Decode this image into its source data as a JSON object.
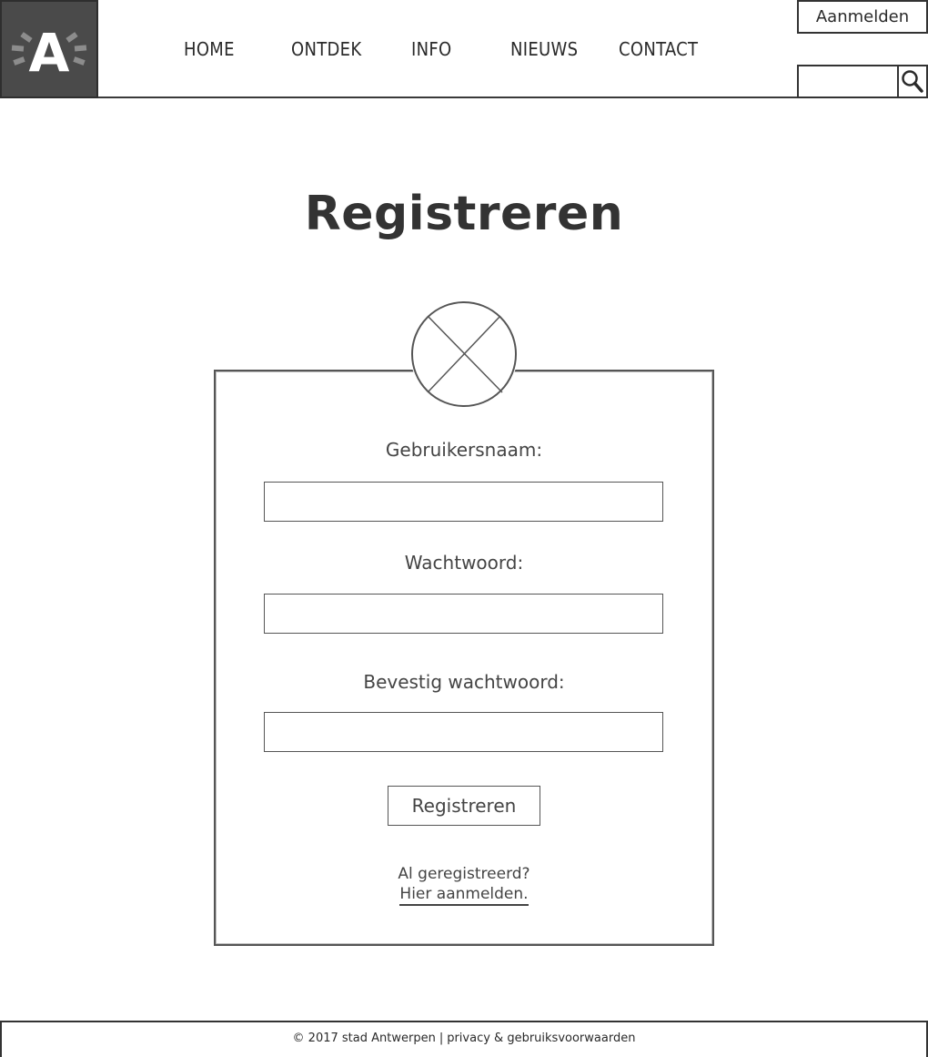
{
  "header": {
    "logo_letter": "A",
    "nav": [
      {
        "label": "HOME"
      },
      {
        "label": "ONTDEK"
      },
      {
        "label": "INFO"
      },
      {
        "label": "NIEUWS"
      },
      {
        "label": "CONTACT"
      }
    ],
    "login_label": "Aanmelden",
    "search_value": "",
    "search_icon": "search-icon"
  },
  "main": {
    "title": "Registreren",
    "avatar_icon": "image-placeholder-icon",
    "fields": [
      {
        "label": "Gebruikersnaam:",
        "value": ""
      },
      {
        "label": "Wachtwoord:",
        "value": ""
      },
      {
        "label": "Bevestig wachtwoord:",
        "value": ""
      }
    ],
    "submit_label": "Registreren",
    "already_text": "Al geregistreerd?",
    "login_link_text": "Hier aanmelden."
  },
  "footer": {
    "copyright": "© 2017 stad Antwerpen",
    "separator": "|",
    "privacy_link": "privacy & gebruiksvoorwaarden"
  },
  "colors": {
    "logo_bg": "#4a4a4a",
    "text": "#333333",
    "border": "#555555"
  }
}
